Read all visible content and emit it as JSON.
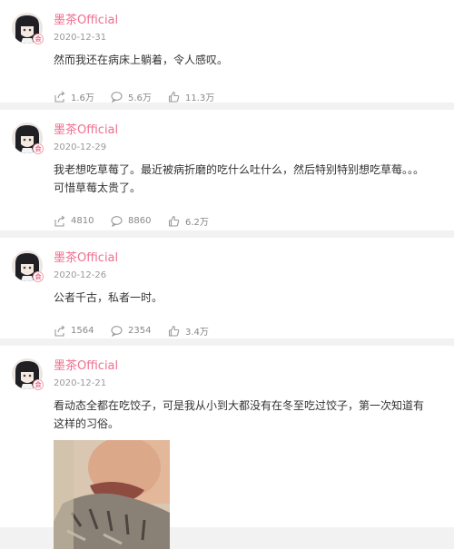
{
  "posts": [
    {
      "username": "墨茶Official",
      "date": "2020-12-31",
      "text": "然而我还在病床上躺着，令人感叹。",
      "shares": "1.6万",
      "comments": "5.6万",
      "likes": "11.3万"
    },
    {
      "username": "墨茶Official",
      "date": "2020-12-29",
      "text": "我老想吃草莓了。最近被病折磨的吃什么吐什么，然后特别特别想吃草莓。。。可惜草莓太贵了。",
      "shares": "4810",
      "comments": "8860",
      "likes": "6.2万"
    },
    {
      "username": "墨茶Official",
      "date": "2020-12-26",
      "text": "公者千古，私者一时。",
      "shares": "1564",
      "comments": "2354",
      "likes": "3.4万"
    },
    {
      "username": "墨茶Official",
      "date": "2020-12-21",
      "text": "看动态全都在吃饺子，可是我从小到大都没有在冬至吃过饺子，第一次知道有这样的习俗。"
    }
  ],
  "badge": "会",
  "icons": {
    "share": "share-icon",
    "comment": "comment-icon",
    "like": "thumbs-up-icon"
  },
  "colors": {
    "username": "#ef6f8f",
    "meta": "#999999",
    "background": "#f2f2f2"
  }
}
